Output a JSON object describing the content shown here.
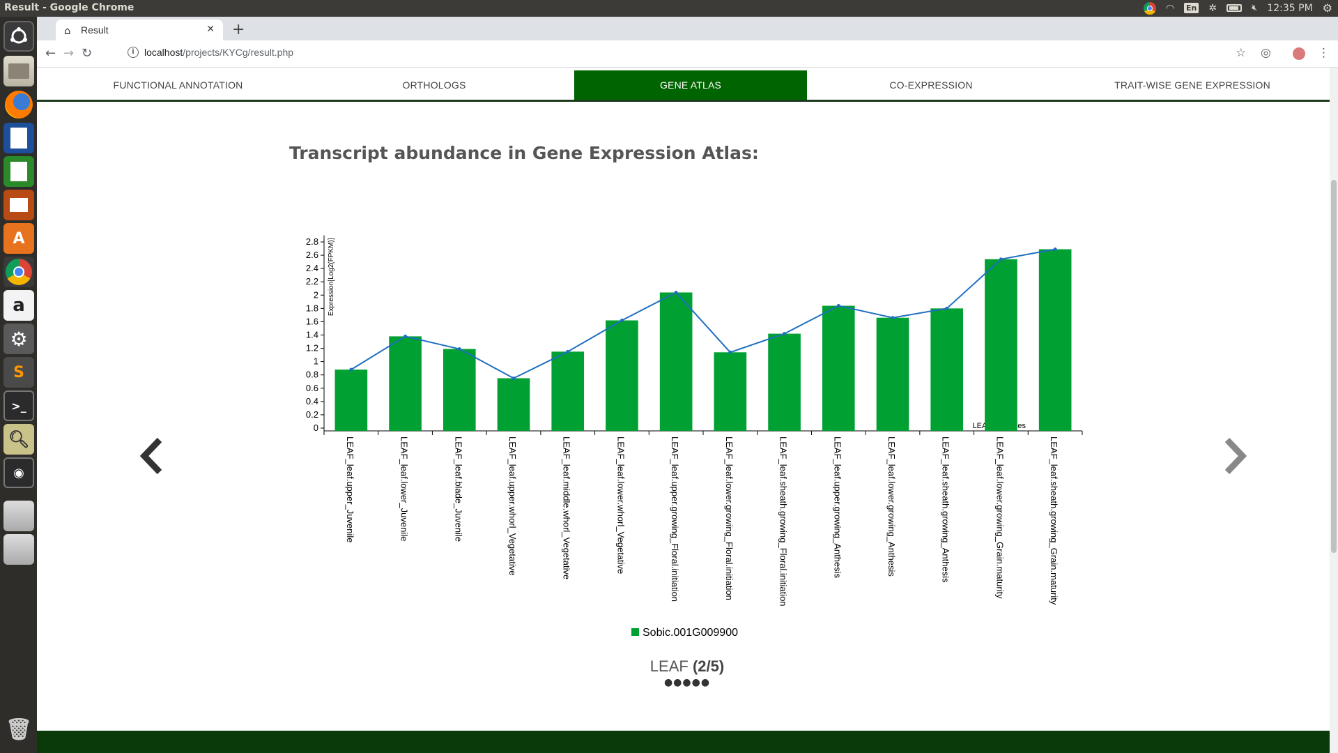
{
  "os": {
    "window_title": "Result - Google Chrome",
    "clock": "12:35 PM",
    "keyboard_layout": "En"
  },
  "browser": {
    "tab_title": "Result",
    "url_host": "localhost",
    "url_path": "/projects/KYCg/result.php"
  },
  "nav": {
    "tabs": [
      {
        "label": "FUNCTIONAL ANNOTATION",
        "active": false
      },
      {
        "label": "ORTHOLOGS",
        "active": false
      },
      {
        "label": "GENE ATLAS",
        "active": true
      },
      {
        "label": "CO-EXPRESSION",
        "active": false
      },
      {
        "label": "TRAIT-WISE GENE EXPRESSION",
        "active": false
      }
    ]
  },
  "main": {
    "heading": "Transcript abundance in Gene Expression Atlas:",
    "slide_tissue": "LEAF",
    "slide_index": "(2/5)",
    "dots": "●●●●●"
  },
  "chart_data": {
    "type": "bar",
    "title": "",
    "xlabel": "LEAF_Samples",
    "ylabel": "Expression[Log2(FPKM)]",
    "ylim": [
      0,
      2.9
    ],
    "yticks": [
      "0",
      "0.2",
      "0.4",
      "0.6",
      "0.8",
      "1",
      "1.2",
      "1.4",
      "1.6",
      "1.8",
      "2",
      "2.2",
      "2.4",
      "2.6",
      "2.8"
    ],
    "categories": [
      "LEAF_leaf.upper_Juvenile",
      "LEAF_leaf.lower_Juvenile",
      "LEAF_leaf.blade_Juvenile",
      "LEAF_leaf.upper.whorl_Vegetative",
      "LEAF_leaf.middle.whorl_Vegetative",
      "LEAF_leaf.lower.whorl_Vegetative",
      "LEAF_leaf.upper.growing_Floral.initiation",
      "LEAF_leaf.lower.growing_Floral.initiation",
      "LEAF_leaf.sheath.growing_Floral.initiation",
      "LEAF_leaf.upper.growing_Anthesis",
      "LEAF_leaf.lower.growing_Anthesis",
      "LEAF_leaf.sheath.growing_Anthesis",
      "LEAF_leaf.lower.growing_Grain.maturity",
      "LEAF_leaf.sheath.growing_Grain.maturity"
    ],
    "series": [
      {
        "name": "Sobic.001G009900",
        "values": [
          0.88,
          1.38,
          1.19,
          0.75,
          1.15,
          1.62,
          2.04,
          1.14,
          1.42,
          1.84,
          1.66,
          1.8,
          2.54,
          2.69
        ]
      }
    ],
    "overlay_line": true,
    "grid": false,
    "legend_position": "bottom",
    "colors": {
      "bar": "#00a032",
      "line": "#1f6fc0"
    }
  },
  "colors": {
    "active_tab": "#006400",
    "footer": "#0a3a0a",
    "heading": "#555555"
  },
  "icons": {
    "prev": "chevron-left-icon",
    "next": "chevron-right-icon"
  }
}
